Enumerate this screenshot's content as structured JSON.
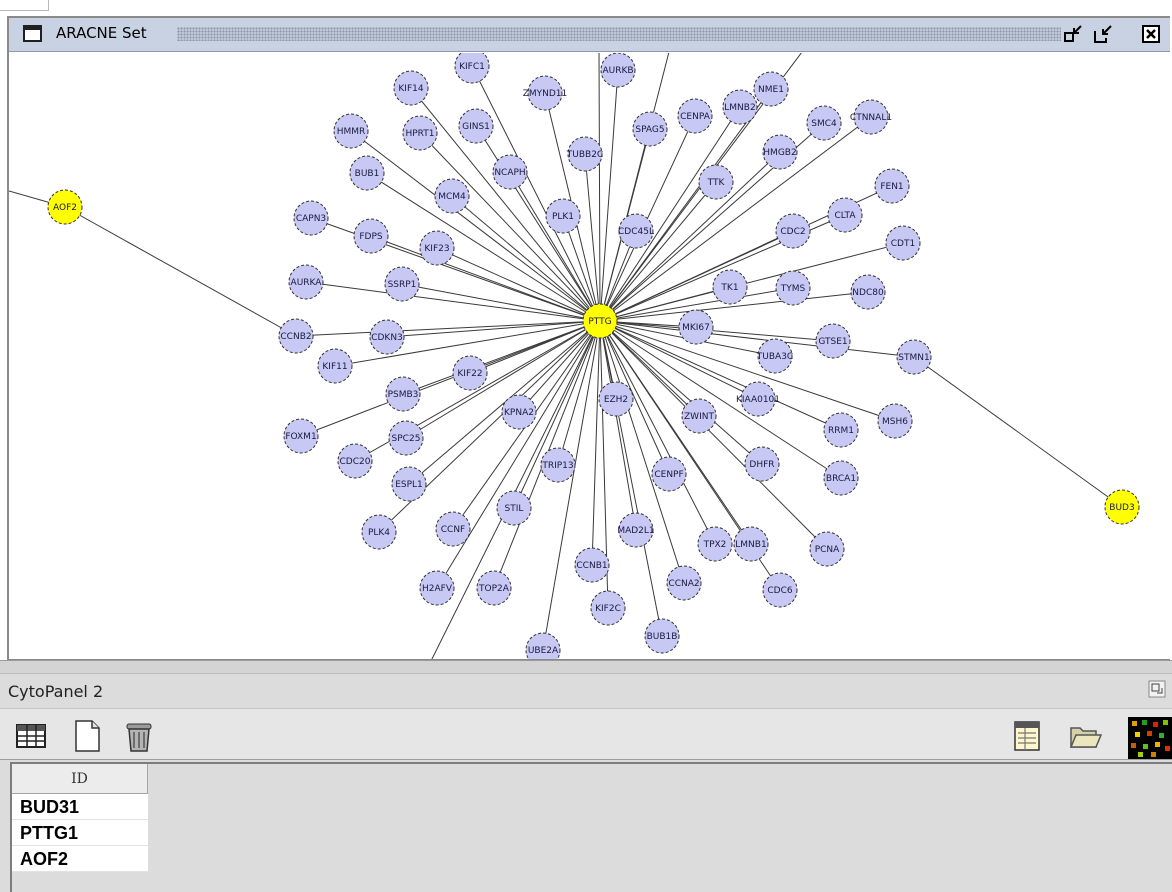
{
  "window": {
    "title": "ARACNE Set"
  },
  "network": {
    "hub": "PTTG",
    "nodes": [
      {
        "id": "PTTG",
        "label": "PTTG",
        "color": "#ffff00"
      },
      {
        "id": "AOF2",
        "label": "AOF2",
        "color": "#ffff00"
      },
      {
        "id": "BUD3",
        "label": "BUD3",
        "color": "#ffff00"
      },
      {
        "id": "CCNB2",
        "label": "CCNB2"
      },
      {
        "id": "STMN1",
        "label": "STMN1"
      },
      {
        "id": "KIF14",
        "label": "KIF14"
      },
      {
        "id": "KIFC1",
        "label": "KIFC1"
      },
      {
        "id": "AURKB",
        "label": "AURKB"
      },
      {
        "id": "ZWYND11",
        "label": "ZMYND11"
      },
      {
        "id": "NME1",
        "label": "NME1"
      },
      {
        "id": "HMMR",
        "label": "HMMR"
      },
      {
        "id": "HPRT1",
        "label": "HPRT1"
      },
      {
        "id": "GINS1",
        "label": "GINS1"
      },
      {
        "id": "CENPA",
        "label": "CENPA"
      },
      {
        "id": "LMNB2",
        "label": "LMNB2"
      },
      {
        "id": "SPAG5",
        "label": "SPAG5"
      },
      {
        "id": "SMC4",
        "label": "SMC4"
      },
      {
        "id": "CTNNAL1",
        "label": "CTNNAL1"
      },
      {
        "id": "TUBB2C",
        "label": "TUBB2C"
      },
      {
        "id": "HMGB2",
        "label": "HMGB2"
      },
      {
        "id": "BUB1",
        "label": "BUB1"
      },
      {
        "id": "NCAPH",
        "label": "NCAPH"
      },
      {
        "id": "TTK",
        "label": "TTK"
      },
      {
        "id": "FEN1",
        "label": "FEN1"
      },
      {
        "id": "MCM4",
        "label": "MCM4"
      },
      {
        "id": "CAPN3",
        "label": "CAPN3"
      },
      {
        "id": "PLK1",
        "label": "PLK1"
      },
      {
        "id": "CLTA",
        "label": "CLTA"
      },
      {
        "id": "FDPS",
        "label": "FDPS"
      },
      {
        "id": "KIF23",
        "label": "KIF23"
      },
      {
        "id": "CDC45L",
        "label": "CDC45L"
      },
      {
        "id": "CDC2",
        "label": "CDC2"
      },
      {
        "id": "CDT1",
        "label": "CDT1"
      },
      {
        "id": "AURKA",
        "label": "AURKA"
      },
      {
        "id": "SSRP1",
        "label": "SSRP1"
      },
      {
        "id": "TK1",
        "label": "TK1"
      },
      {
        "id": "TYMS",
        "label": "TYMS"
      },
      {
        "id": "NDC80",
        "label": "NDC80"
      },
      {
        "id": "CDKN3",
        "label": "CDKN3"
      },
      {
        "id": "MKI67",
        "label": "MKI67"
      },
      {
        "id": "GTSE1",
        "label": "GTSE1"
      },
      {
        "id": "KIF11",
        "label": "KIF11"
      },
      {
        "id": "KIF22",
        "label": "KIF22"
      },
      {
        "id": "TUBA3C",
        "label": "TUBA3C"
      },
      {
        "id": "PSMB3",
        "label": "PSMB3"
      },
      {
        "id": "KPNA2",
        "label": "KPNA2"
      },
      {
        "id": "EZH2",
        "label": "EZH2"
      },
      {
        "id": "KIAA0101",
        "label": "KIAA0101"
      },
      {
        "id": "ZWINT",
        "label": "ZWINT"
      },
      {
        "id": "MSH6",
        "label": "MSH6"
      },
      {
        "id": "FOXM1",
        "label": "FOXM1"
      },
      {
        "id": "SPC25",
        "label": "SPC25"
      },
      {
        "id": "RRM1",
        "label": "RRM1"
      },
      {
        "id": "CDC20",
        "label": "CDC20"
      },
      {
        "id": "TRIP13",
        "label": "TRIP13"
      },
      {
        "id": "DHFR",
        "label": "DHFR"
      },
      {
        "id": "BRCA1",
        "label": "BRCA1"
      },
      {
        "id": "ESPL1",
        "label": "ESPL1"
      },
      {
        "id": "CENPF",
        "label": "CENPF"
      },
      {
        "id": "STIL",
        "label": "STIL"
      },
      {
        "id": "PLK4",
        "label": "PLK4"
      },
      {
        "id": "CCNF",
        "label": "CCNF"
      },
      {
        "id": "MAD2L1",
        "label": "MAD2L1"
      },
      {
        "id": "TPX2",
        "label": "TPX2"
      },
      {
        "id": "LMNB1",
        "label": "LMNB1"
      },
      {
        "id": "PCNA",
        "label": "PCNA"
      },
      {
        "id": "CCNB1",
        "label": "CCNB1"
      },
      {
        "id": "H2AFV",
        "label": "H2AFV"
      },
      {
        "id": "TOP2A",
        "label": "TOP2A"
      },
      {
        "id": "CCNA2",
        "label": "CCNA2"
      },
      {
        "id": "CDC6",
        "label": "CDC6"
      },
      {
        "id": "KIF2C",
        "label": "KIF2C"
      },
      {
        "id": "BUB1B",
        "label": "BUB1B"
      },
      {
        "id": "UBE2A",
        "label": "UBE2A"
      }
    ],
    "edges": [
      [
        "AOF2",
        "CCNB2"
      ],
      [
        "STMN1",
        "BUD3"
      ]
    ]
  },
  "cytopanel": {
    "title": "CytoPanel 2",
    "table": {
      "column": "ID",
      "rows": [
        "BUD31",
        "PTTG1",
        "AOF2"
      ]
    }
  }
}
